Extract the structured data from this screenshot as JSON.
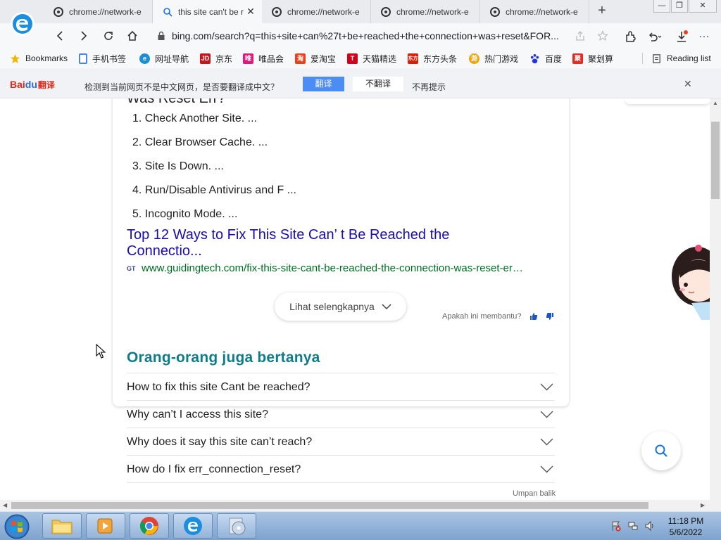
{
  "browser": {
    "tabs": [
      {
        "title": "chrome://network-e",
        "icon": "chrome-page-icon",
        "active": false
      },
      {
        "title": "this site can't be r",
        "icon": "search-icon",
        "active": true
      },
      {
        "title": "chrome://network-e",
        "icon": "chrome-page-icon",
        "active": false
      },
      {
        "title": "chrome://network-e",
        "icon": "chrome-page-icon",
        "active": false
      },
      {
        "title": "chrome://network-e",
        "icon": "chrome-page-icon",
        "active": false
      }
    ],
    "new_tab_label": "+",
    "tab_close_label": "✕",
    "window_controls": {
      "minimize": "—",
      "restore": "❐",
      "close": "✕"
    },
    "url": "bing.com/search?q=this+site+can%27t+be+reached+the+connection+was+reset&FOR..."
  },
  "bookmarks": [
    {
      "label": "Bookmarks",
      "icon": "star-icon",
      "color": "#f5b400"
    },
    {
      "label": "手机书签",
      "icon": "phone-icon",
      "color": "#4a86e8"
    },
    {
      "label": "网址导航",
      "icon": "ie-icon",
      "color": "#1a8fd8"
    },
    {
      "label": "京东",
      "icon": "jd-icon",
      "color": "#c4161c"
    },
    {
      "label": "唯品会",
      "icon": "vip-icon",
      "color": "#e0197d"
    },
    {
      "label": "爱淘宝",
      "icon": "taobao-icon",
      "color": "#e8421c"
    },
    {
      "label": "天猫精选",
      "icon": "tmall-icon",
      "color": "#d0021b"
    },
    {
      "label": "东方头条",
      "icon": "toutiao-icon",
      "color": "#d81e06"
    },
    {
      "label": "热门游戏",
      "icon": "game-icon",
      "color": "#f0a30a"
    },
    {
      "label": "百度",
      "icon": "baidu-paw-icon",
      "color": "#2932e1"
    },
    {
      "label": "聚划算",
      "icon": "juhuasuan-icon",
      "color": "#e02e24"
    },
    {
      "label": "Reading list",
      "icon": "reading-list-icon",
      "color": "#444444"
    }
  ],
  "translate_bar": {
    "logo_bai": "Bai",
    "logo_du": "du",
    "logo_fy": "翻译",
    "message": "检测到当前网页不是中文网页，是否要翻译成中文？",
    "translate_label": "翻译",
    "dont_translate_label": "不翻译",
    "never_label": "不再提示",
    "close_label": "✕"
  },
  "content": {
    "heading_cut": "Was Reset Err?",
    "steps": [
      "1. Check Another Site. ...",
      "2. Clear Browser Cache. ...",
      "3. Site Is Down. ...",
      "4. Run/Disable Antivirus and F ...",
      "5. Incognito Mode. ..."
    ],
    "result_title": "Top 12 Ways to Fix This Site Can’ t Be Reached the Connectio...",
    "result_favicon": "GT",
    "result_url": "www.guidingtech.com/fix-this-site-cant-be-reached-the-connection-was-reset-er…",
    "see_more": "Lihat selengkapnya",
    "helpful": "Apakah ini membantu?",
    "paa_title": "Orang-orang juga bertanya",
    "paa_questions": [
      "How to fix this site Cant be reached?",
      "Why can’t I access this site?",
      "Why does it say this site can’t reach?",
      "How do I fix err_connection_reset?"
    ],
    "feedback": "Umpan balik"
  },
  "taskbar": {
    "time": "11:18 PM",
    "date": "5/6/2022"
  },
  "colors": {
    "link_blue": "#1a0dab",
    "url_green": "#006d21",
    "paa_teal": "#0f7c8a",
    "translate_blue": "#4c8cf5"
  }
}
